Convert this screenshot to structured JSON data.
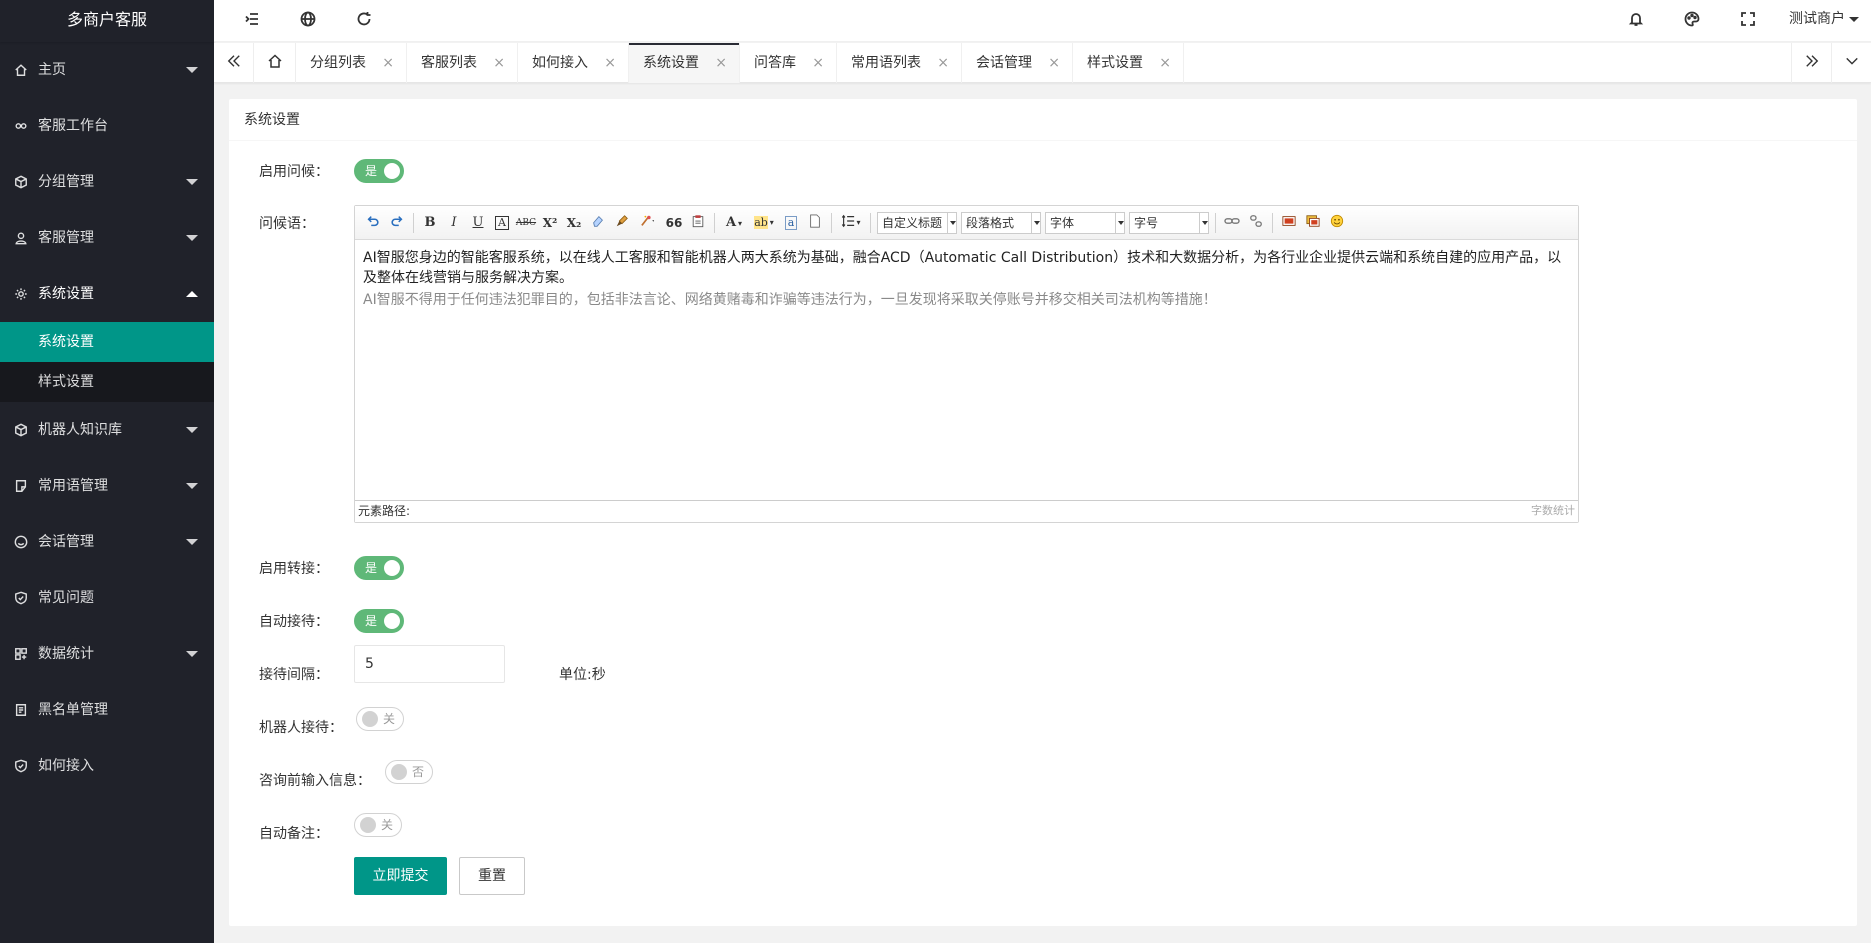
{
  "brand": "多商户客服",
  "sidebar": {
    "items": [
      {
        "label": "主页",
        "icon": "home-icon"
      },
      {
        "label": "客服工作台",
        "icon": "link-icon"
      },
      {
        "label": "分组管理",
        "icon": "cube-icon"
      },
      {
        "label": "客服管理",
        "icon": "user-icon"
      },
      {
        "label": "系统设置",
        "icon": "gear-icon"
      },
      {
        "label": "机器人知识库",
        "icon": "cube-icon"
      },
      {
        "label": "常用语管理",
        "icon": "note-icon"
      },
      {
        "label": "会话管理",
        "icon": "smile-icon"
      },
      {
        "label": "常见问题",
        "icon": "shield-icon"
      },
      {
        "label": "数据统计",
        "icon": "grid-icon"
      },
      {
        "label": "黑名单管理",
        "icon": "list-icon"
      },
      {
        "label": "如何接入",
        "icon": "shield-icon"
      }
    ],
    "submenu": [
      {
        "label": "系统设置"
      },
      {
        "label": "样式设置"
      }
    ]
  },
  "header": {
    "user": "测试商户"
  },
  "tabs": [
    {
      "label": "分组列表"
    },
    {
      "label": "客服列表"
    },
    {
      "label": "如何接入"
    },
    {
      "label": "系统设置"
    },
    {
      "label": "问答库"
    },
    {
      "label": "常用语列表"
    },
    {
      "label": "会话管理"
    },
    {
      "label": "样式设置"
    }
  ],
  "tab_close": "×",
  "card": {
    "title": "系统设置"
  },
  "form": {
    "greet_enable": {
      "label": "启用问候：",
      "value": "是"
    },
    "greet_text": {
      "label": "问候语："
    },
    "transfer_enable": {
      "label": "启用转接：",
      "value": "是"
    },
    "auto_reception": {
      "label": "自动接待：",
      "value": "是"
    },
    "interval": {
      "label": "接待间隔：",
      "value": "5",
      "unit": "单位:秒"
    },
    "robot": {
      "label": "机器人接待：",
      "value": "关"
    },
    "pre_info": {
      "label": "咨询前输入信息：",
      "value": "否"
    },
    "auto_note": {
      "label": "自动备注：",
      "value": "关"
    },
    "submit": "立即提交",
    "reset": "重置"
  },
  "editor": {
    "paragraph1": "AI智服您身边的智能客服系统，以在线人工客服和智能机器人两大系统为基础，融合ACD（Automatic Call Distribution）技术和大数据分析，为各行业企业提供云端和系统自建的应用产品，以及整体在线营销与服务解决方案。",
    "paragraph2": "AI智服不得用于任何违法犯罪目的，包括非法言论、网络黄赌毒和诈骗等违法行为，一旦发现将采取关停账号并移交相关司法机构等措施！",
    "path_label": "元素路径:",
    "word_count": "字数统计",
    "selects": {
      "heading": "自定义标题",
      "paragraph": "段落格式",
      "font": "字体",
      "size": "字号"
    },
    "buttons": {
      "bold": "B",
      "italic": "I",
      "underline": "U",
      "border": "A",
      "strike": "ABC",
      "superscript": "X²",
      "subscript": "X₂",
      "quote": "66",
      "fontcolor": "A",
      "bgcolor": "ab",
      "autotype": "a"
    }
  },
  "colors": {
    "sidebar_bg": "#20222a",
    "accent": "#009688",
    "switch_on": "#5fb878"
  }
}
